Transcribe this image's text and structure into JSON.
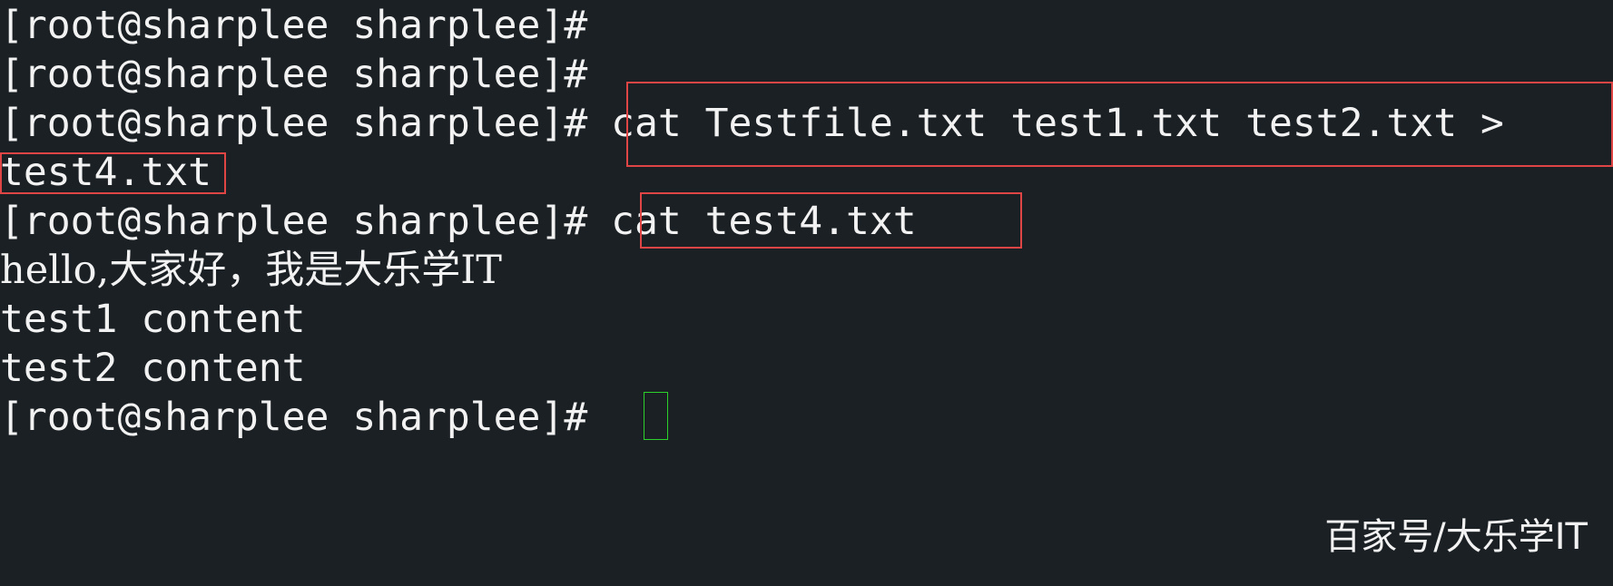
{
  "terminal": {
    "prompt": "[root@sharplee sharplee]#",
    "lines": [
      {
        "prompt": "[root@sharplee sharplee]#",
        "text": ""
      },
      {
        "prompt": "[root@sharplee sharplee]#",
        "text": ""
      },
      {
        "prompt": "[root@sharplee sharplee]#",
        "text": " cat Testfile.txt test1.txt test2.txt >"
      },
      {
        "prompt": "",
        "text": "test4.txt"
      },
      {
        "prompt": "[root@sharplee sharplee]#",
        "text": " cat test4.txt"
      },
      {
        "prompt": "",
        "text": "hello,大家好，我是大乐学IT"
      },
      {
        "prompt": "",
        "text": "test1 content"
      },
      {
        "prompt": "",
        "text": "test2 content"
      },
      {
        "prompt": "[root@sharplee sharplee]#",
        "text": " "
      }
    ]
  },
  "watermark": "百家号/大乐学IT",
  "colors": {
    "background": "#1b2024",
    "text": "#f2f2f2",
    "highlight_box": "#e04545",
    "cursor": "#2bd02b"
  }
}
